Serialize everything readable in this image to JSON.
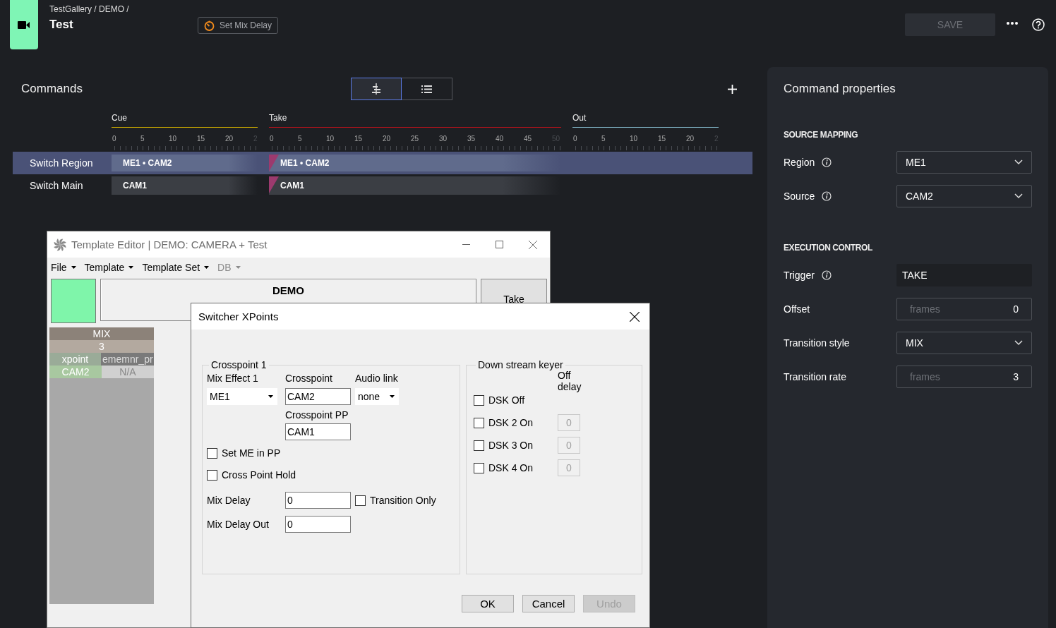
{
  "header": {
    "breadcrumb": "TestGallery / DEMO /",
    "title": "Test",
    "action_button": "Set Mix Delay",
    "save_button": {
      "label": "SAVE",
      "disabled": true
    }
  },
  "commands": {
    "title": "Commands",
    "views": [
      {
        "kind": "timeline",
        "selected": true
      },
      {
        "kind": "list",
        "selected": false
      }
    ],
    "phases": [
      {
        "label": "Cue",
        "color": "#c9a800",
        "ticks": [
          "0",
          "5",
          "10",
          "15",
          "20",
          "2"
        ]
      },
      {
        "label": "Take",
        "color": "#b3121c",
        "ticks": [
          "0",
          "5",
          "10",
          "15",
          "20",
          "25",
          "30",
          "35",
          "40",
          "45",
          "50"
        ]
      },
      {
        "label": "Out",
        "color": "#7fb3c4",
        "ticks": [
          "0",
          "5",
          "10",
          "15",
          "20",
          "2"
        ]
      }
    ],
    "rows": [
      {
        "name": "Switch Region",
        "selected": true,
        "blocks": [
          {
            "label": "ME1 • CAM2",
            "marker": false
          },
          {
            "label": "ME1 • CAM2",
            "marker": true
          }
        ]
      },
      {
        "name": "Switch Main",
        "selected": false,
        "blocks": [
          {
            "label": "CAM1",
            "marker": false
          },
          {
            "label": "CAM1",
            "marker": true
          }
        ]
      }
    ]
  },
  "properties": {
    "title": "Command properties",
    "sections": [
      {
        "heading": "SOURCE MAPPING",
        "fields": [
          {
            "label": "Region",
            "info": true,
            "kind": "select",
            "value": "ME1"
          },
          {
            "label": "Source",
            "info": true,
            "kind": "select",
            "value": "CAM2"
          }
        ]
      },
      {
        "heading": "EXECUTION CONTROL",
        "fields": [
          {
            "label": "Trigger",
            "info": true,
            "kind": "readonly",
            "value": "TAKE"
          },
          {
            "label": "Offset",
            "info": false,
            "kind": "number",
            "placeholder": "frames",
            "value": "0"
          },
          {
            "label": "Transition style",
            "info": false,
            "kind": "select",
            "value": "MIX"
          },
          {
            "label": "Transition rate",
            "info": false,
            "kind": "number",
            "placeholder": "frames",
            "value": "3"
          }
        ]
      }
    ]
  },
  "template_editor": {
    "title": "Template Editor | DEMO: CAMERA + Test",
    "menus": [
      {
        "label": "File",
        "disabled": false
      },
      {
        "label": "Template",
        "disabled": false
      },
      {
        "label": "Template Set",
        "disabled": false
      },
      {
        "label": "DB",
        "disabled": true
      }
    ],
    "banner": "DEMO",
    "take_button": "Take",
    "grid": [
      [
        "MIX"
      ],
      [
        "3"
      ],
      [
        "xpoint",
        "ememnr_pr"
      ],
      [
        "CAM2",
        "N/A"
      ]
    ]
  },
  "dialog": {
    "title": "Switcher XPoints",
    "crosspoint": {
      "title": "Crosspoint 1",
      "mix_effect_label": "Mix Effect 1",
      "mix_effect": "ME1",
      "crosspoint_label": "Crosspoint",
      "crosspoint": "CAM2",
      "audio_link_label": "Audio link",
      "audio_link": "none",
      "crosspoint_pp_label": "Crosspoint PP",
      "crosspoint_pp": "CAM1",
      "checks": [
        {
          "label": "Set ME in PP",
          "checked": false
        },
        {
          "label": "Cross Point Hold",
          "checked": false
        }
      ],
      "mix_delay_label": "Mix Delay",
      "mix_delay": "0",
      "transition_only": {
        "label": "Transition Only",
        "checked": false
      },
      "mix_delay_out_label": "Mix Delay Out",
      "mix_delay_out": "0"
    },
    "dsk": {
      "title": "Down stream keyer",
      "off_delay_label": "Off delay",
      "items": [
        {
          "label": "DSK Off",
          "checked": false
        },
        {
          "label": "DSK 2 On",
          "checked": false,
          "delay": "0"
        },
        {
          "label": "DSK 3 On",
          "checked": false,
          "delay": "0"
        },
        {
          "label": "DSK 4 On",
          "checked": false,
          "delay": "0"
        }
      ]
    },
    "buttons": [
      {
        "label": "OK",
        "disabled": false
      },
      {
        "label": "Cancel",
        "disabled": false
      },
      {
        "label": "Undo",
        "disabled": true
      }
    ]
  }
}
